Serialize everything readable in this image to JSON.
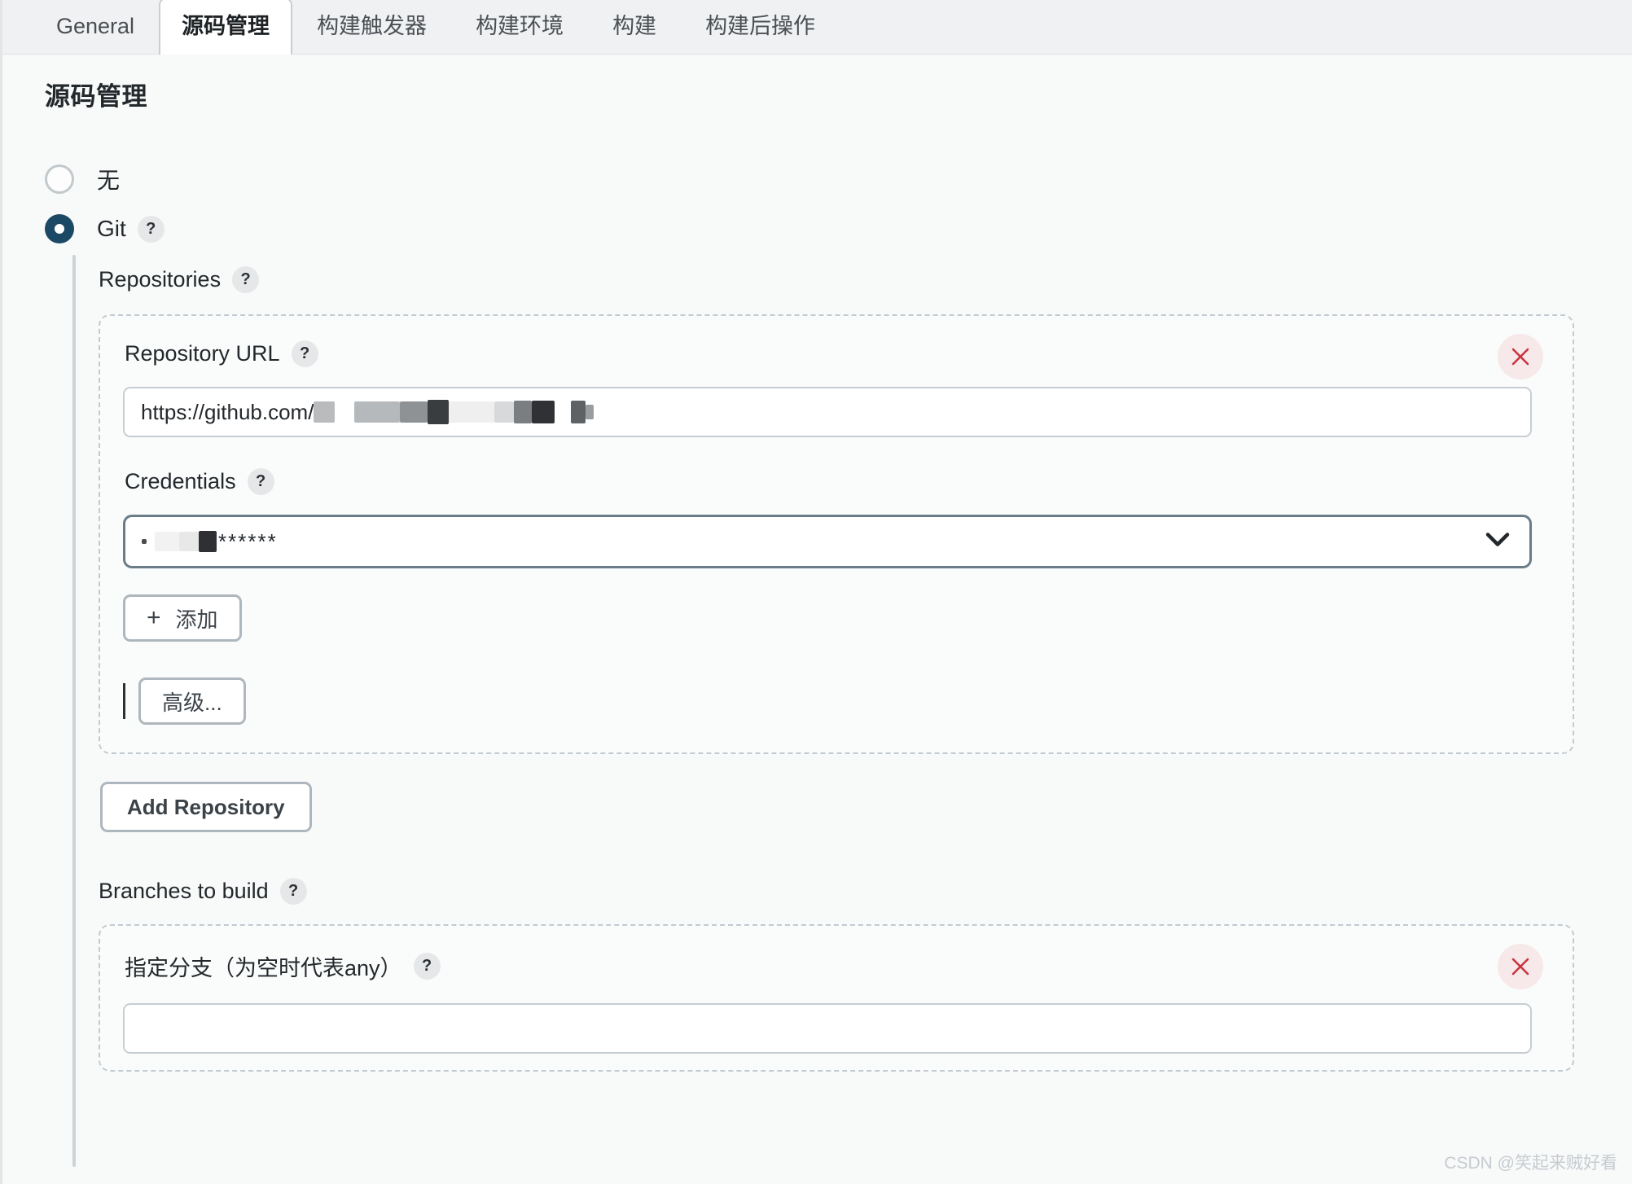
{
  "tabs": [
    {
      "label": "General",
      "active": false
    },
    {
      "label": "源码管理",
      "active": true
    },
    {
      "label": "构建触发器",
      "active": false
    },
    {
      "label": "构建环境",
      "active": false
    },
    {
      "label": "构建",
      "active": false
    },
    {
      "label": "构建后操作",
      "active": false
    }
  ],
  "page": {
    "title": "源码管理",
    "help_glyph": "?"
  },
  "scm": {
    "options": [
      {
        "label": "无",
        "selected": false,
        "has_help": false
      },
      {
        "label": "Git",
        "selected": true,
        "has_help": true
      }
    ]
  },
  "repositories": {
    "label": "Repositories",
    "repo": {
      "url_label": "Repository URL",
      "url_value": "https://github.com/",
      "url_redacted_note": "redacted",
      "credentials_label": "Credentials",
      "credentials_value": "******",
      "add_credentials_button": "添加",
      "add_credentials_icon": "plus-icon",
      "advanced_button": "高级...",
      "remove_icon": "close-icon"
    },
    "add_repository_button": "Add Repository"
  },
  "branches": {
    "label": "Branches to build",
    "branch": {
      "specifier_label": "指定分支（为空时代表any）",
      "specifier_value": "",
      "remove_icon": "close-icon"
    }
  },
  "watermark": "CSDN @笑起来贼好看",
  "colors": {
    "accent": "#1b4965",
    "danger": "#c9353f",
    "border": "#c6ced4",
    "page_bg": "#f8f9f9",
    "tabbar_bg": "#f0f1f2"
  }
}
